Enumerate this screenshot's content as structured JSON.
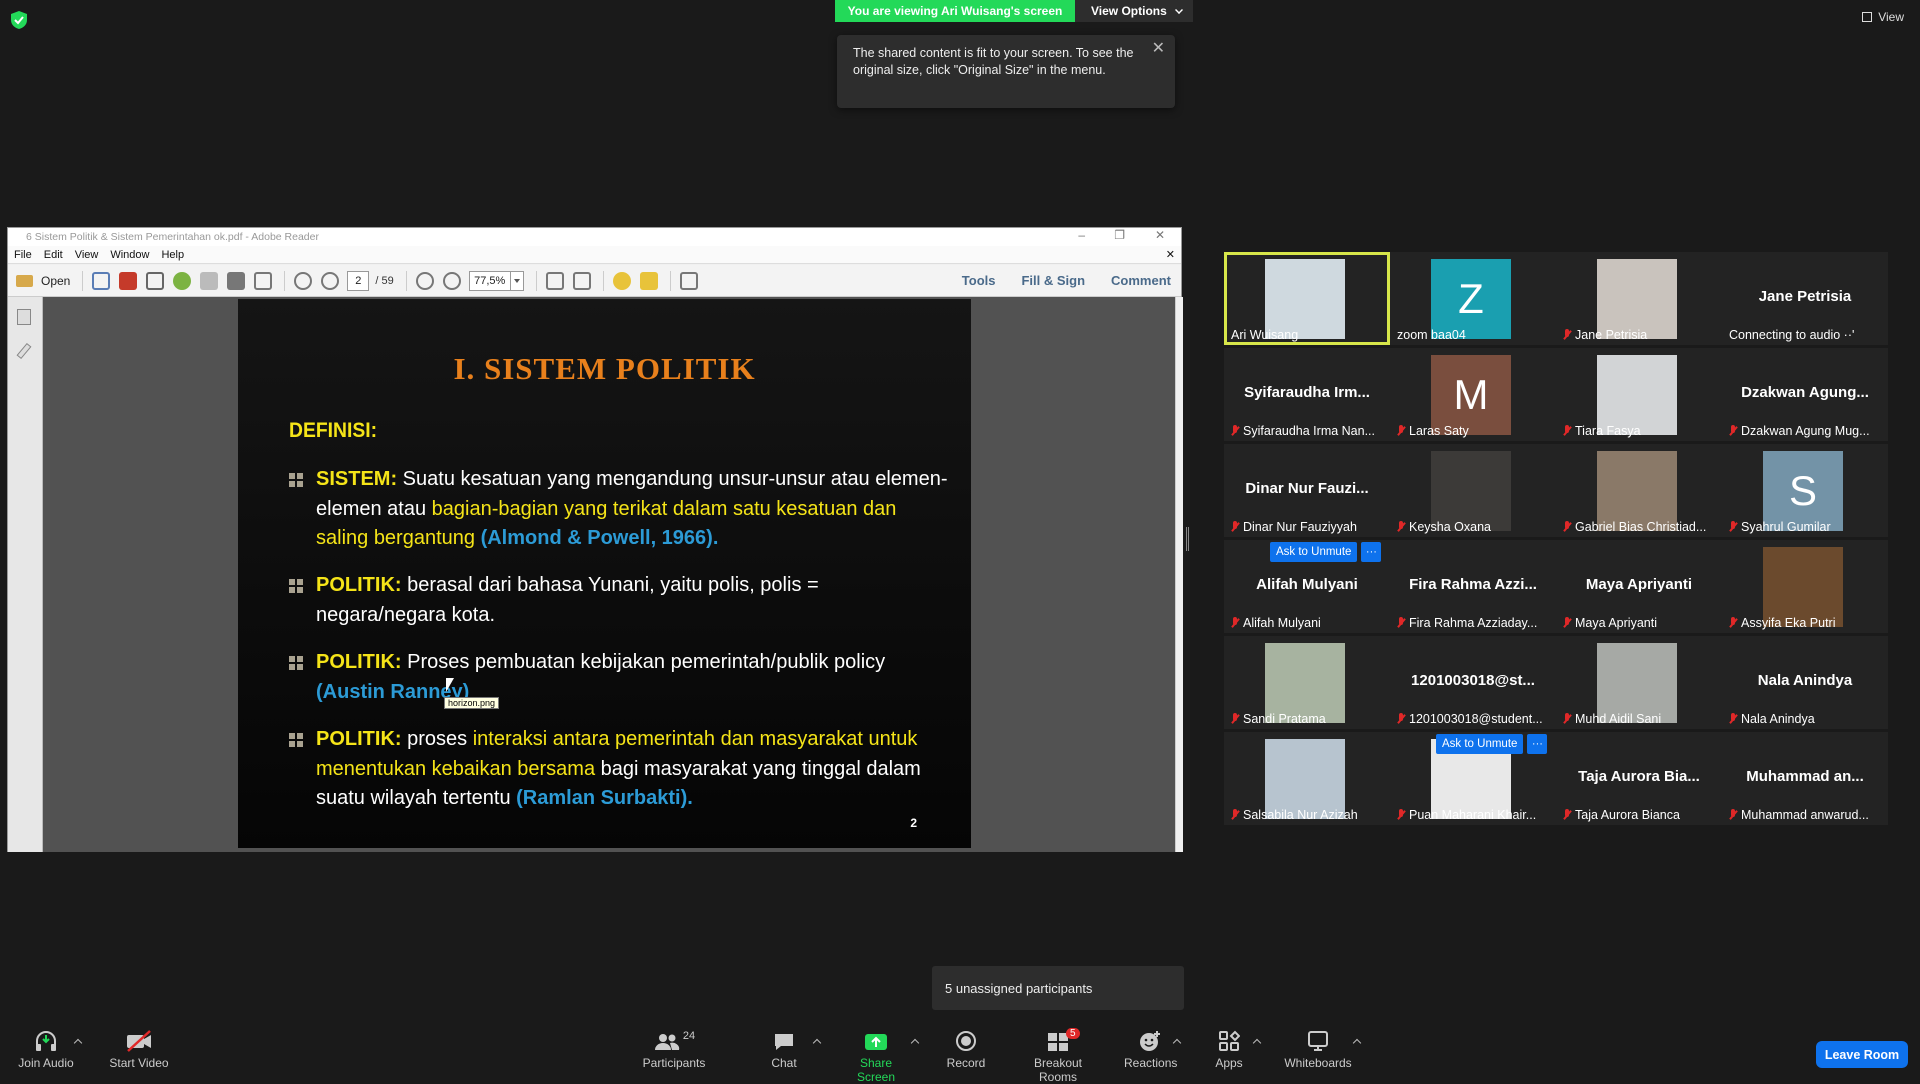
{
  "top": {
    "viewing_banner": "You are viewing Ari Wuisang's screen",
    "view_options": "View Options",
    "view_label": "View",
    "notice": "The shared content is fit to your screen. To see the original size, click \"Original Size\" in the menu."
  },
  "reader": {
    "title": "6 Sistem Politik & Sistem Pemerintahan ok.pdf - Adobe Reader",
    "menu": [
      "File",
      "Edit",
      "View",
      "Window",
      "Help"
    ],
    "open_label": "Open",
    "page_current": "2",
    "page_total": "/ 59",
    "zoom": "77,5%",
    "right_buttons": [
      "Tools",
      "Fill & Sign",
      "Comment"
    ]
  },
  "slide": {
    "title": "I. SISTEM  POLITIK",
    "definisi": "DEFINISI:",
    "b1": {
      "key": "SISTEM:",
      "t1": " Suatu kesatuan yang mengandung unsur-unsur atau elemen-elemen atau ",
      "y1": "bagian-bagian yang terikat dalam satu kesatuan dan saling bergantung",
      "c1": " (Almond & Powell, 1966)."
    },
    "b2": {
      "key": "POLITIK:",
      "t1": " berasal dari bahasa Yunani, yaitu polis, polis = negara/negara kota."
    },
    "b3": {
      "key": "POLITIK:",
      "t1": " Proses pembuatan kebijakan pemerintah/publik policy ",
      "c1": "(Austin Ranney)"
    },
    "b4": {
      "key": "POLITIK:",
      "t1": " proses ",
      "y1": "interaksi antara pemerintah dan masyarakat untuk menentukan kebaikan bersama",
      "t2": " bagi masyarakat yang tinggal dalam suatu wilayah tertentu  ",
      "c1": "(Ramlan Surbakti)."
    },
    "page_number": "2",
    "cursor_tooltip": "horizon.png"
  },
  "participants": [
    {
      "label": "Ari Wuisang",
      "big": "",
      "type": "photo",
      "color": "#cfd9df",
      "muted": false,
      "active": true
    },
    {
      "label": "zoom baa04",
      "big": "",
      "type": "letter",
      "letter": "Z",
      "color": "#1a9fb0",
      "muted": false
    },
    {
      "label": "Jane Petrisia",
      "big": "",
      "type": "photo",
      "color": "#c9c3bd",
      "muted": true
    },
    {
      "label": "Connecting to audio ··'",
      "big": "Jane Petrisia",
      "type": "name",
      "muted": false
    },
    {
      "label": "Syifaraudha Irma Nan...",
      "big": "Syifaraudha Irm...",
      "type": "name",
      "muted": true
    },
    {
      "label": "Laras Saty",
      "big": "",
      "type": "letter",
      "letter": "M",
      "color": "#7a4e3e",
      "muted": true
    },
    {
      "label": "Tiara Fasya",
      "big": "",
      "type": "photo",
      "color": "#d2d4d6",
      "muted": true
    },
    {
      "label": "Dzakwan Agung Mug...",
      "big": "Dzakwan Agung...",
      "type": "name",
      "muted": true
    },
    {
      "label": "Dinar Nur Fauziyyah",
      "big": "Dinar Nur Fauzi...",
      "type": "name",
      "muted": true
    },
    {
      "label": "Keysha Oxana",
      "big": "",
      "type": "photo",
      "color": "#3c3a38",
      "muted": true
    },
    {
      "label": "Gabriel Bias Christiad...",
      "big": "",
      "type": "photo",
      "color": "#8a7968",
      "muted": true
    },
    {
      "label": "Syahrul Gumilar",
      "big": "",
      "type": "letter",
      "letter": "S",
      "color": "#7393a7",
      "muted": true
    },
    {
      "label": "Alifah Mulyani",
      "big": "Alifah Mulyani",
      "type": "name",
      "muted": true,
      "ask_unmute": "Ask to Unmute"
    },
    {
      "label": "Fira Rahma Azziaday...",
      "big": "Fira Rahma Azzi...",
      "type": "name",
      "muted": true
    },
    {
      "label": "Maya Apriyanti",
      "big": "Maya Apriyanti",
      "type": "name",
      "muted": true
    },
    {
      "label": "Assyifa Eka Putri",
      "big": "",
      "type": "photo",
      "color": "#6b4a2d",
      "muted": true
    },
    {
      "label": "Sandi Pratama",
      "big": "",
      "type": "photo",
      "color": "#a7b3a0",
      "muted": true
    },
    {
      "label": "1201003018@student...",
      "big": "1201003018@st...",
      "type": "name",
      "muted": true
    },
    {
      "label": "Muhd Aidil Sani",
      "big": "",
      "type": "photo",
      "color": "#a6a9a5",
      "muted": true
    },
    {
      "label": "Nala Anindya",
      "big": "Nala Anindya",
      "type": "name",
      "muted": true
    },
    {
      "label": "Salsabila Nur Azizah",
      "big": "",
      "type": "photo",
      "color": "#b7c4cf",
      "muted": true
    },
    {
      "label": "Puan Maharani Khair...",
      "big": "",
      "type": "photo",
      "color": "#e8e8e8",
      "muted": true,
      "ask_unmute": "Ask to Unmute"
    },
    {
      "label": "Taja Aurora Bianca",
      "big": "Taja Aurora Bia...",
      "type": "name",
      "muted": true
    },
    {
      "label": "Muhammad anwarud...",
      "big": "Muhammad an...",
      "type": "name",
      "muted": true
    }
  ],
  "bottom": {
    "unassigned": "5 unassigned participants",
    "join_audio": "Join Audio",
    "start_video": "Start Video",
    "participants": "Participants",
    "participants_count": "24",
    "chat": "Chat",
    "share_screen": "Share Screen",
    "record": "Record",
    "breakout_rooms": "Breakout Rooms",
    "breakout_badge": "5",
    "reactions": "Reactions",
    "apps": "Apps",
    "whiteboards": "Whiteboards",
    "leave_room": "Leave Room"
  },
  "colors": {
    "zoom_green": "#23d959",
    "zoom_blue": "#0e72ed",
    "slide_title": "#e8801c",
    "slide_yellow": "#f5e418",
    "slide_cyan": "#2c9bd6",
    "muted_red": "#e02828"
  }
}
